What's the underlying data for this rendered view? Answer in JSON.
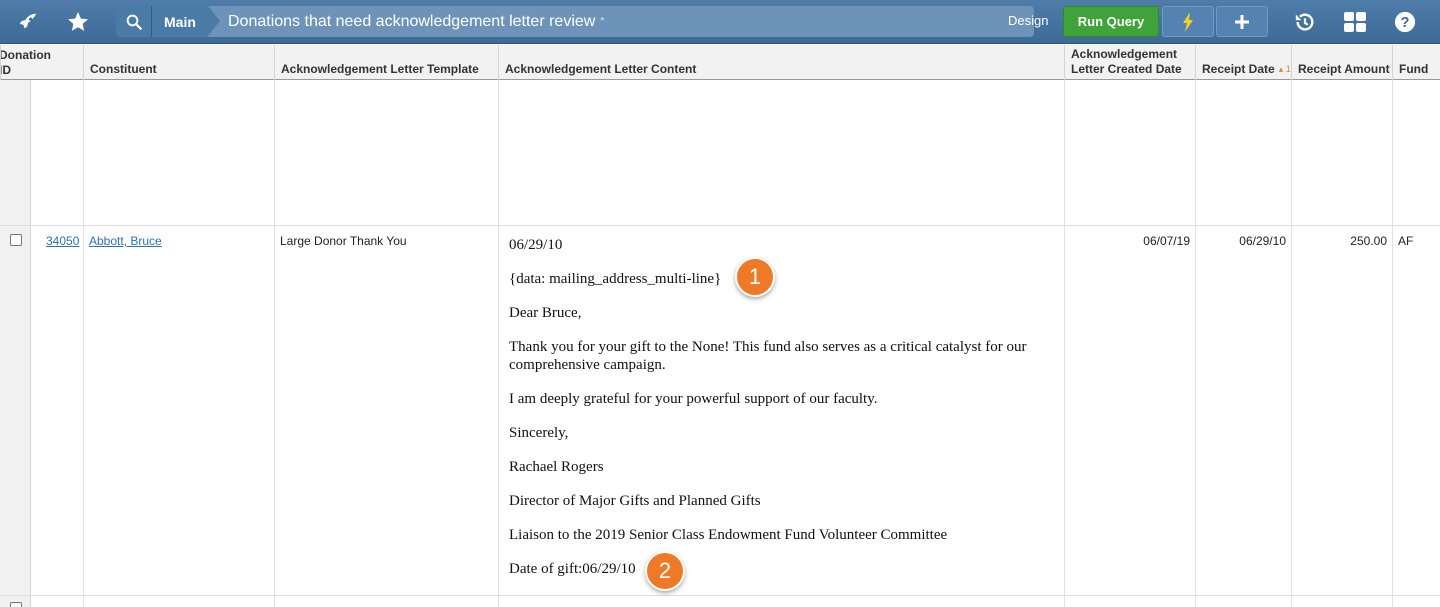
{
  "toolbar": {
    "breadcrumb_main": "Main",
    "query_title": "Donations that need acknowledgement letter review",
    "modified_marker": "*",
    "design_label": "Design",
    "run_query_label": "Run Query",
    "icons": [
      "rocket-icon",
      "star-icon",
      "search-icon",
      "lightning-icon",
      "plus-icon",
      "history-icon",
      "grid-icon",
      "help-icon"
    ]
  },
  "columns": [
    "Donation ID",
    "Constituent",
    "Acknowledgement Letter Template",
    "Acknowledgement Letter Content",
    "Acknowledgement Letter Created Date",
    "Receipt Date",
    "Receipt Amount",
    "Fund"
  ],
  "header_display": {
    "donation_id_line1": "Donation",
    "donation_id_line2": "ID",
    "created_line1": "Acknowledgement",
    "created_line2": "Letter Created Date",
    "sort_indicator": "▴ 1"
  },
  "rows": [
    {
      "donation_id": "34050",
      "constituent": "Abbott, Bruce",
      "template": "Large Donor Thank You",
      "letter": {
        "date": "06/29/10",
        "address_token": "{data: mailing_address_multi-line}",
        "salutation": "Dear Bruce,",
        "body1": "Thank you for your gift to the None! This fund also serves as a critical catalyst for our comprehensive campaign.",
        "body2": "I am deeply grateful for your powerful support of our faculty.",
        "closing": "Sincerely,",
        "signer": "Rachael Rogers",
        "signer_title": "Director of Major Gifts and Planned Gifts",
        "signer_role": "Liaison to the 2019 Senior Class Endowment Fund Volunteer Committee",
        "gift_date_line": "Date of gift:06/29/10"
      },
      "created_date": "06/07/19",
      "receipt_date": "06/29/10",
      "receipt_amount": "250.00",
      "fund": "AF"
    }
  ],
  "callouts": [
    "1",
    "2"
  ]
}
